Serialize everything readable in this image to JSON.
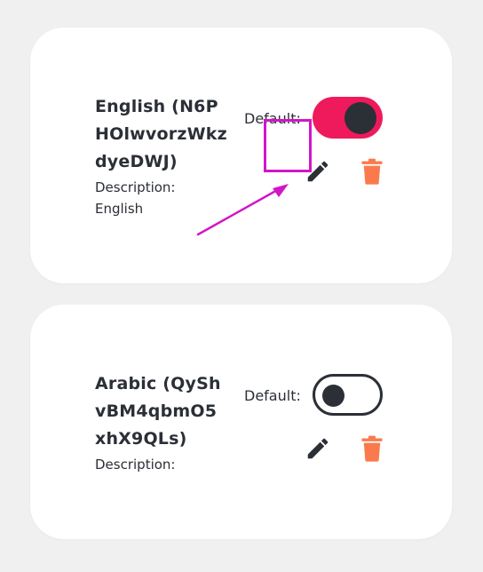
{
  "languages": [
    {
      "title": "English (N6P\nHOlwvorzWkz\ndyeDWJ)",
      "description": "Description:\nEnglish",
      "default_label": "Default:",
      "is_default": true
    },
    {
      "title": "Arabic (QySh\nvBM4qbmO5\nxhX9QLs)",
      "description": "Description:",
      "default_label": "Default:",
      "is_default": false
    }
  ],
  "colors": {
    "toggle_on": "#ee1a5c",
    "toggle_knob": "#2b2f36",
    "delete_icon": "#fb7a4d",
    "annotation": "#d116c8"
  },
  "icons": {
    "edit": "pencil-icon",
    "delete": "trash-icon"
  }
}
